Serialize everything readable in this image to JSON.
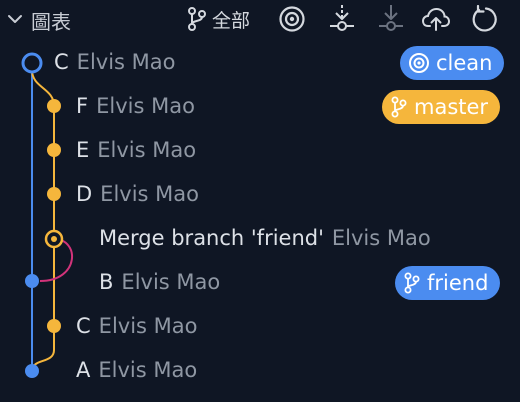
{
  "header": {
    "title": "圖表",
    "filter_label": "全部"
  },
  "commits": [
    {
      "message": "C",
      "author": "Elvis Mao",
      "badge": {
        "label": "clean",
        "icon": "target-icon",
        "color": "#4b8cf0"
      }
    },
    {
      "message": "F",
      "author": "Elvis Mao",
      "badge": {
        "label": "master",
        "icon": "branch-icon",
        "color": "#f5b63c"
      }
    },
    {
      "message": "E",
      "author": "Elvis Mao"
    },
    {
      "message": "D",
      "author": "Elvis Mao"
    },
    {
      "message": "Merge branch 'friend'",
      "author": "Elvis Mao"
    },
    {
      "message": "B",
      "author": "Elvis Mao",
      "badge": {
        "label": "friend",
        "icon": "branch-icon",
        "color": "#4b8cf0"
      }
    },
    {
      "message": "C",
      "author": "Elvis Mao"
    },
    {
      "message": "A",
      "author": "Elvis Mao"
    }
  ],
  "colors": {
    "background": "#0f1624",
    "lane_blue": "#4b8cf0",
    "lane_orange": "#f5b63c",
    "merge_pink": "#d2337a"
  }
}
